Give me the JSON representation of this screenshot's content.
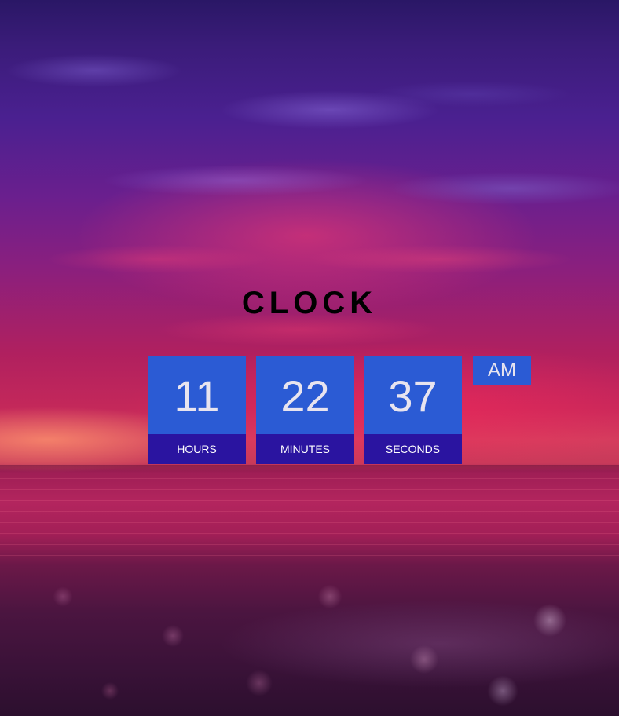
{
  "title": "CLOCK",
  "clock": {
    "hours": {
      "value": "11",
      "label": "Hours"
    },
    "minutes": {
      "value": "22",
      "label": "Minutes"
    },
    "seconds": {
      "value": "37",
      "label": "Seconds"
    },
    "period": "AM"
  },
  "colors": {
    "tile_background": "#2b5bd4",
    "label_background": "#2a14a0",
    "digit_text": "#e8e4ef",
    "title_text": "#000000"
  },
  "background": {
    "scene": "sunset-seascape-image"
  }
}
